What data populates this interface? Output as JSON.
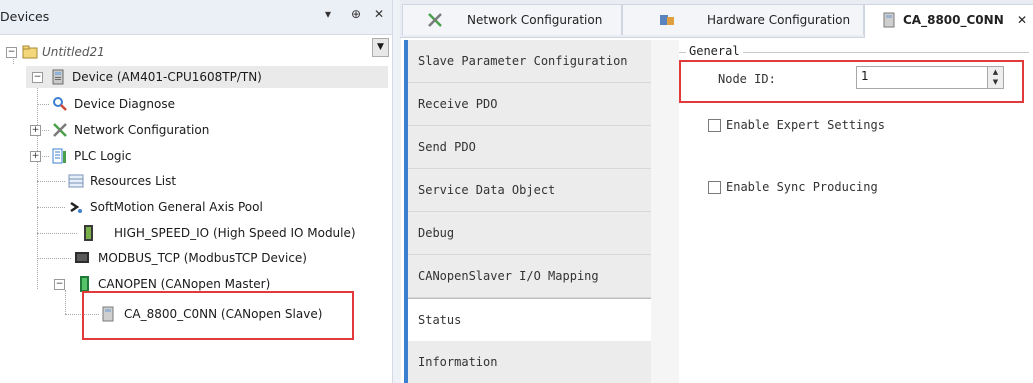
{
  "devices_panel": {
    "title": "Devices",
    "controls": {
      "dropdown": "▾",
      "pin": "⊕",
      "close": "✕"
    },
    "tree": {
      "root": "Untitled21",
      "device": "Device (AM401-CPU1608TP/TN)",
      "children": [
        "Device Diagnose",
        "Network Configuration",
        "PLC Logic",
        "Resources List",
        "SoftMotion General Axis Pool",
        "HIGH_SPEED_IO (High Speed IO Module)",
        "MODBUS_TCP (ModbusTCP Device)",
        "CANOPEN (CANopen Master)"
      ],
      "selected_slave": "CA_8800_C0NN (CANopen Slave)"
    },
    "icons": [
      "folder-icon",
      "device-icon",
      "diagnose-icon",
      "network-icon",
      "plc-logic-icon",
      "resources-icon",
      "axis-pool-icon",
      "io-module-icon",
      "modbus-icon",
      "canopen-master-icon",
      "canopen-slave-icon"
    ]
  },
  "editor_tabs": [
    {
      "label": "Network Configuration",
      "icon": "network-icon"
    },
    {
      "label": "Hardware Configuration",
      "icon": "hardware-icon"
    },
    {
      "label": "CA_8800_C0NN",
      "icon": "canopen-slave-icon",
      "active": true,
      "close": "✕"
    }
  ],
  "side_nav": [
    "Slave Parameter Configuration",
    "Receive PDO",
    "Send PDO",
    "Service Data Object",
    "Debug",
    "CANopenSlaver I/O Mapping",
    "Status",
    "Information"
  ],
  "side_nav_active": "Status",
  "general": {
    "title": "General",
    "node_id_label": "Node ID:",
    "node_id_value": "1",
    "enable_expert": "Enable Expert Settings",
    "enable_sync": "Enable Sync Producing",
    "enable_expert_checked": false,
    "enable_sync_checked": false
  },
  "colors": {
    "highlight": "#e03a3a",
    "accent": "#3c7fd0",
    "panel_header": "#ebeff6"
  }
}
